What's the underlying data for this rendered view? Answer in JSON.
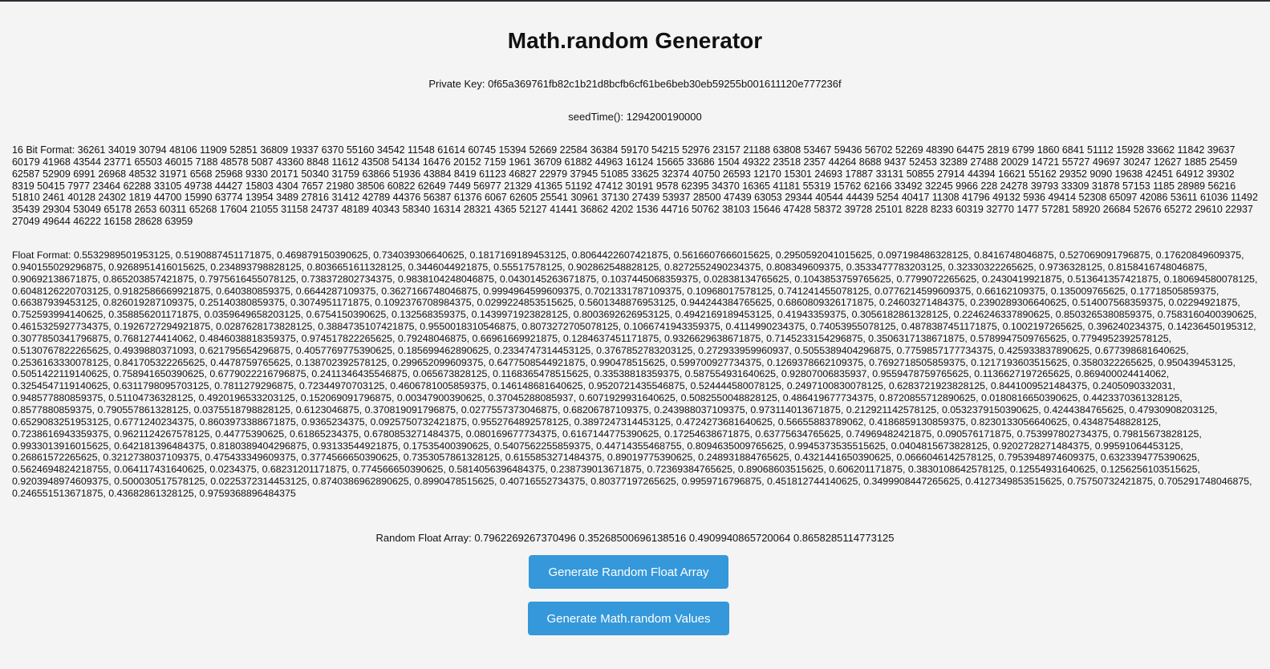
{
  "page": {
    "title": "Math.random Generator",
    "private_key_label": "Private Key:",
    "private_key_value": "0f65a369761fb82c1b21d8bcfb6cf61be6beb30eb59255b001611120e777236f",
    "seed_time_label": "seedTime():",
    "seed_time_value": "1294200190000",
    "bit16_label": "16 Bit Format:",
    "bit16_values": "36261 34019 30794 48106 11909 52851 36809 19337 6370 55160 34542 11548 61614 60745 15394 52669 22584 36384 59170 54215 52976 23157 21188 63808 53467 59436 56702 52269 48390 64475 2819 6799 1860 6841 51112 15928 33662 11842 39637 60179 41968 43544 23771 65503 46015 7188 48578 5087 43360 8848 11612 43508 54134 16476 20152 7159 1961 36709 61882 44963 16124 15665 33686 1504 49322 23518 2357 44264 8688 9437 52453 32389 27488 20029 14721 55727 49697 30247 12627 1885 25459 62587 52909 6991 26968 48532 31971 6568 25968 9330 20171 50340 31759 63866 51936 43884 8419 61123 46827 22979 37945 51085 33625 32374 40750 26593 12170 15301 24693 17887 33131 50855 27914 44394 16621 55162 29352 9090 19638 42451 64912 39302 8319 50415 7977 23464 62288 33105 49738 44427 15803 4304 7657 21980 38506 60822 62649 7449 56977 21329 41365 51192 47412 30191 9578 62395 34370 16365 41181 55319 15762 62166 33492 32245 9966 228 24278 39793 33309 31878 57153 1185 28989 56216 51810 2461 40128 24302 1819 44700 15990 63774 13954 3489 27816 31412 42789 44376 56387 61376 6067 62605 25541 30961 37130 27439 53937 28500 47439 63053 29344 40544 44439 5254 40417 11308 41796 49132 5936 49414 52308 65097 42086 53611 61036 11492 35439 29304 53049 65178 2653 60311 65268 17604 21055 31158 24737 48189 40343 58340 16314 28321 4365 52127 41441 36862 4202 1536 44716 50762 38103 15646 47428 58372 39728 25101 8228 8233 60319 32770 1477 57281 58920 26684 52676 65272 29610 22937 27049 49644 46222 16158 28628 63959",
    "float_label": "Float Format:",
    "float_values": "0.5532989501953125, 0.5190887451171875, 0.469879150390625, 0.734039306640625, 0.1817169189453125, 0.8064422607421875, 0.5616607666015625, 0.2950592041015625, 0.097198486328125, 0.8416748046875, 0.527069091796875, 0.17620849609375, 0.940155029296875, 0.9268951416015625, 0.234893798828125, 0.8036651611328125, 0.3446044921875, 0.55517578125, 0.902862548828125, 0.8272552490234375, 0.808349609375, 0.3533477783203125, 0.32330322265625, 0.9736328125, 0.8158416748046875, 0.90692138671875, 0.865203857421875, 0.7975616455078125, 0.738372802734375, 0.9838104248046875, 0.0430145263671875, 0.1037445068359375, 0.02838134765625, 0.1043853759765625, 0.7799072265625, 0.2430419921875, 0.513641357421875, 0.180694580078125, 0.6048126220703125, 0.9182586669921875, 0.640380859375, 0.6644287109375, 0.3627166748046875, 0.9994964599609375, 0.7021331787109375, 0.10968017578125, 0.741241455078125, 0.0776214599609375, 0.66162109375, 0.135009765625, 0.17718505859375, 0.66387939453125, 0.826019287109375, 0.25140380859375, 0.3074951171875, 0.1092376708984375, 0.0299224853515625, 0.5601348876953125, 0.944244384765625, 0.6860809326171875, 0.24603271484375, 0.2390289306640625, 0.514007568359375, 0.02294921875, 0.752593994140625, 0.358856201171875, 0.0359649658203125, 0.6754150390625, 0.132568359375, 0.1439971923828125, 0.8003692626953125, 0.4942169189453125, 0.41943359375, 0.3056182861328125, 0.2246246337890625, 0.8503265380859375, 0.7583160400390625, 0.4615325927734375, 0.1926727294921875, 0.0287628173828125, 0.3884735107421875, 0.9550018310546875, 0.8073272705078125, 0.1066741943359375, 0.4114990234375, 0.74053955078125, 0.4878387451171875, 0.1002197265625, 0.396240234375, 0.14236450195312, 0.3077850341796875, 0.7681274414062, 0.4846038818359375, 0.974517822265625, 0.79248046875, 0.66961669921875, 0.1284637451171875, 0.9326629638671875, 0.7145233154296875, 0.3506317138671875, 0.5789947509765625, 0.7794952392578125, 0.5130767822265625, 0.4939880371093, 0.621795654296875, 0.4057769775390625, 0.185699462890625, 0.2334747314453125, 0.3767852783203125, 0.272933959960937, 0.5055389404296875, 0.7759857177734375, 0.425933837890625, 0.677398681640625, 0.2536163330078125, 0.841705322265625, 0.4478759765625, 0.138702392578125, 0.299652099609375, 0.6477508544921875, 0.990478515625, 0.599700927734375, 0.1269378662109375, 0.7692718505859375, 0.1217193603515625, 0.3580322265625, 0.950439453125, 0.5051422119140625, 0.758941650390625, 0.6779022216796875, 0.2411346435546875, 0.065673828125, 0.1168365478515625, 0.33538818359375, 0.587554931640625, 0.92807006835937, 0.9559478759765625, 0.1136627197265625, 0.869400024414062, 0.3254547119140625, 0.6311798095703125, 0.7811279296875, 0.72344970703125, 0.4606781005859375, 0.146148681640625, 0.9520721435546875, 0.524444580078125, 0.2497100830078125, 0.6283721923828125, 0.8441009521484375, 0.2405090332031, 0.948577880859375, 0.51104736328125, 0.4920196533203125, 0.152069091796875, 0.00347900390625, 0.37045288085937, 0.6071929931640625, 0.5082550048828125, 0.486419677734375, 0.8720855712890625, 0.0180816650390625, 0.4423370361328125, 0.8577880859375, 0.790557861328125, 0.0375518798828125, 0.6123046875, 0.370819091796875, 0.0277557373046875, 0.68206787109375, 0.243988037109375, 0.973114013671875, 0.212921142578125, 0.0532379150390625, 0.4244384765625, 0.47930908203125, 0.6529083251953125, 0.6771240234375, 0.8603973388671875, 0.9365234375, 0.0925750732421875, 0.9552764892578125, 0.3897247314453125, 0.4724273681640625, 0.56655883789062, 0.4186859130859375, 0.8230133056640625, 0.43487548828125, 0.7238616943359375, 0.9621124267578125, 0.44775390625, 0.61865234375, 0.6780853271484375, 0.080169677734375, 0.6167144775390625, 0.17254638671875, 0.63775634765625, 0.74969482421875, 0.090576171875, 0.753997802734375, 0.79815673828125, 0.9933013916015625, 0.642181396484375, 0.8180389404296875, 0.93133544921875, 0.17535400390625, 0.5407562255859375, 0.44714355468755, 0.8094635009765625, 0.9945373535515625, 0.0404815673828125, 0.9202728271484375, 0.99591064453125, 0.26861572265625, 0.3212738037109375, 0.475433349609375, 0.3774566650390625, 0.7353057861328125, 0.6155853271484375, 0.89019775390625, 0.248931884765625, 0.4321441650390625, 0.0666046142578125, 0.7953948974609375, 0.6323394775390625, 0.5624694824218755, 0.064117431640625, 0.0234375, 0.68231201171875, 0.774566650390625, 0.5814056396484375, 0.238739013671875, 0.72369384765625, 0.89068603515625, 0.606201171875, 0.3830108642578125, 0.12554931640625, 0.1256256103515625, 0.9203948974609375, 0.500030517578125, 0.0225372314453125, 0.8740386962890625, 0.8990478515625, 0.40716552734375, 0.80377197265625, 0.9959716796875, 0.451812744140625, 0.3499908447265625, 0.4127349853515625, 0.75750732421875, 0.705291748046875, 0.246551513671875, 0.43682861328125, 0.9759368896484375",
    "random_float_label": "Random Float Array:",
    "random_float_values": "0.7962269267370496 0.35268500696138516 0.4909940865720064 0.8658285114773125",
    "button_float_array": "Generate Random Float Array",
    "button_math_random": "Generate Math.random Values"
  },
  "colors": {
    "background": "#f4f4f4",
    "button": "#3498db",
    "button_text": "#ffffff",
    "text": "#111111"
  }
}
